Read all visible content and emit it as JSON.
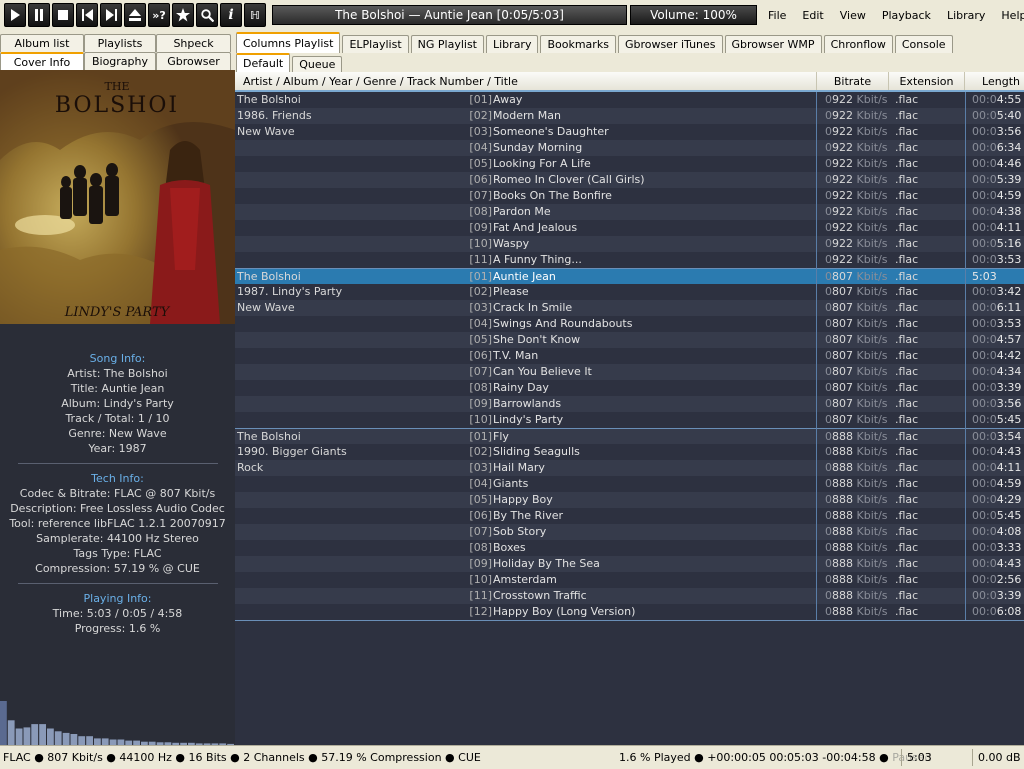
{
  "toolbar": {
    "play": "play-icon",
    "pause": "pause-icon",
    "stop": "stop-icon",
    "previous": "previous-icon",
    "next": "next-icon",
    "eject": "eject-icon",
    "random_label": "»?",
    "favorite": "star-icon",
    "search": "search-icon",
    "info_label": "i",
    "tags_label": "ℍ"
  },
  "now_playing": "The Bolshoi — Auntie Jean [0:05/5:03]",
  "volume": "Volume: 100%",
  "menu": [
    "File",
    "Edit",
    "View",
    "Playback",
    "Library",
    "Help"
  ],
  "left_tabs_row1": [
    "Album list",
    "Playlists",
    "Shpeck"
  ],
  "left_tabs_row2": [
    "Cover Info",
    "Biography",
    "Gbrowser"
  ],
  "cover": {
    "band": "THE BOLSHOI",
    "album": "LINDY'S PARTY"
  },
  "song_info": {
    "header": "Song Info:",
    "artist": "Artist: The Bolshoi",
    "title": "Title: Auntie Jean",
    "album": "Album: Lindy's Party",
    "track": "Track / Total: 1 / 10",
    "genre": "Genre: New Wave",
    "year": "Year: 1987"
  },
  "tech_info": {
    "header": "Tech Info:",
    "codec": "Codec & Bitrate: FLAC @ 807 Kbit/s",
    "description": "Description: Free Lossless Audio Codec",
    "tool": "Tool: reference libFLAC 1.2.1 20070917",
    "samplerate": "Samplerate: 44100 Hz Stereo",
    "tags": "Tags Type: FLAC",
    "compression": "Compression: 57.19 % @ CUE"
  },
  "playing_info": {
    "header": "Playing Info:",
    "time": "Time: 5:03 / 0:05 / 4:58",
    "progress": "Progress: 1.6 %"
  },
  "visualizer_levels": [
    0.8,
    0.45,
    0.3,
    0.32,
    0.38,
    0.38,
    0.3,
    0.25,
    0.22,
    0.2,
    0.16,
    0.16,
    0.12,
    0.12,
    0.1,
    0.1,
    0.08,
    0.08,
    0.06,
    0.06,
    0.05,
    0.05,
    0.04,
    0.04,
    0.04,
    0.03,
    0.03,
    0.03,
    0.03,
    0.02
  ],
  "playlist_tabs": [
    "Columns Playlist",
    "ELPlaylist",
    "NG Playlist",
    "Library",
    "Bookmarks",
    "Gbrowser iTunes",
    "Gbrowser WMP",
    "Chronflow",
    "Console"
  ],
  "sub_tabs": [
    "Default",
    "Queue"
  ],
  "columns": {
    "main": "Artist / Album / Year / Genre / Track Number / Title",
    "bitrate": "Bitrate",
    "extension": "Extension",
    "length": "Length"
  },
  "tracks": [
    {
      "group": "The Bolshoi",
      "num": "[01]",
      "title": "Away",
      "br_dim": "0",
      "br": "922",
      "unit": "Kbit/s",
      "ext": ".flac",
      "len_dim": "00:0",
      "len": "4:55"
    },
    {
      "group": "1986. Friends",
      "num": "[02]",
      "title": "Modern Man",
      "br_dim": "0",
      "br": "922",
      "unit": "Kbit/s",
      "ext": ".flac",
      "len_dim": "00:0",
      "len": "5:40"
    },
    {
      "group": "New Wave",
      "num": "[03]",
      "title": "Someone's Daughter",
      "br_dim": "0",
      "br": "922",
      "unit": "Kbit/s",
      "ext": ".flac",
      "len_dim": "00:0",
      "len": "3:56"
    },
    {
      "group": "",
      "num": "[04]",
      "title": "Sunday Morning",
      "br_dim": "0",
      "br": "922",
      "unit": "Kbit/s",
      "ext": ".flac",
      "len_dim": "00:0",
      "len": "6:34"
    },
    {
      "group": "",
      "num": "[05]",
      "title": "Looking For A Life",
      "br_dim": "0",
      "br": "922",
      "unit": "Kbit/s",
      "ext": ".flac",
      "len_dim": "00:0",
      "len": "4:46"
    },
    {
      "group": "",
      "num": "[06]",
      "title": "Romeo In Clover (Call Girls)",
      "br_dim": "0",
      "br": "922",
      "unit": "Kbit/s",
      "ext": ".flac",
      "len_dim": "00:0",
      "len": "5:39"
    },
    {
      "group": "",
      "num": "[07]",
      "title": "Books On The Bonfire",
      "br_dim": "0",
      "br": "922",
      "unit": "Kbit/s",
      "ext": ".flac",
      "len_dim": "00:0",
      "len": "4:59"
    },
    {
      "group": "",
      "num": "[08]",
      "title": "Pardon Me",
      "br_dim": "0",
      "br": "922",
      "unit": "Kbit/s",
      "ext": ".flac",
      "len_dim": "00:0",
      "len": "4:38"
    },
    {
      "group": "",
      "num": "[09]",
      "title": "Fat And Jealous",
      "br_dim": "0",
      "br": "922",
      "unit": "Kbit/s",
      "ext": ".flac",
      "len_dim": "00:0",
      "len": "4:11"
    },
    {
      "group": "",
      "num": "[10]",
      "title": "Waspy",
      "br_dim": "0",
      "br": "922",
      "unit": "Kbit/s",
      "ext": ".flac",
      "len_dim": "00:0",
      "len": "5:16"
    },
    {
      "group": "",
      "num": "[11]",
      "title": "A Funny Thing...",
      "br_dim": "0",
      "br": "922",
      "unit": "Kbit/s",
      "ext": ".flac",
      "len_dim": "00:0",
      "len": "3:53"
    },
    {
      "group": "The Bolshoi",
      "num": "[01]",
      "title": "Auntie Jean",
      "br_dim": "0",
      "br": "807",
      "unit": "Kbit/s",
      "ext": ".flac",
      "len_dim": "",
      "len": "5:03",
      "playing": true
    },
    {
      "group": "1987. Lindy's Party",
      "num": "[02]",
      "title": "Please",
      "br_dim": "0",
      "br": "807",
      "unit": "Kbit/s",
      "ext": ".flac",
      "len_dim": "00:0",
      "len": "3:42"
    },
    {
      "group": "New Wave",
      "num": "[03]",
      "title": "Crack In Smile",
      "br_dim": "0",
      "br": "807",
      "unit": "Kbit/s",
      "ext": ".flac",
      "len_dim": "00:0",
      "len": "6:11"
    },
    {
      "group": "",
      "num": "[04]",
      "title": "Swings And Roundabouts",
      "br_dim": "0",
      "br": "807",
      "unit": "Kbit/s",
      "ext": ".flac",
      "len_dim": "00:0",
      "len": "3:53"
    },
    {
      "group": "",
      "num": "[05]",
      "title": "She Don't Know",
      "br_dim": "0",
      "br": "807",
      "unit": "Kbit/s",
      "ext": ".flac",
      "len_dim": "00:0",
      "len": "4:57"
    },
    {
      "group": "",
      "num": "[06]",
      "title": "T.V. Man",
      "br_dim": "0",
      "br": "807",
      "unit": "Kbit/s",
      "ext": ".flac",
      "len_dim": "00:0",
      "len": "4:42"
    },
    {
      "group": "",
      "num": "[07]",
      "title": "Can You Believe It",
      "br_dim": "0",
      "br": "807",
      "unit": "Kbit/s",
      "ext": ".flac",
      "len_dim": "00:0",
      "len": "4:34"
    },
    {
      "group": "",
      "num": "[08]",
      "title": "Rainy Day",
      "br_dim": "0",
      "br": "807",
      "unit": "Kbit/s",
      "ext": ".flac",
      "len_dim": "00:0",
      "len": "3:39"
    },
    {
      "group": "",
      "num": "[09]",
      "title": "Barrowlands",
      "br_dim": "0",
      "br": "807",
      "unit": "Kbit/s",
      "ext": ".flac",
      "len_dim": "00:0",
      "len": "3:56"
    },
    {
      "group": "",
      "num": "[10]",
      "title": "Lindy's Party",
      "br_dim": "0",
      "br": "807",
      "unit": "Kbit/s",
      "ext": ".flac",
      "len_dim": "00:0",
      "len": "5:45"
    },
    {
      "group": "The Bolshoi",
      "num": "[01]",
      "title": "Fly",
      "br_dim": "0",
      "br": "888",
      "unit": "Kbit/s",
      "ext": ".flac",
      "len_dim": "00:0",
      "len": "3:54"
    },
    {
      "group": "1990. Bigger Giants",
      "num": "[02]",
      "title": "Sliding Seagulls",
      "br_dim": "0",
      "br": "888",
      "unit": "Kbit/s",
      "ext": ".flac",
      "len_dim": "00:0",
      "len": "4:43"
    },
    {
      "group": "Rock",
      "num": "[03]",
      "title": "Hail Mary",
      "br_dim": "0",
      "br": "888",
      "unit": "Kbit/s",
      "ext": ".flac",
      "len_dim": "00:0",
      "len": "4:11"
    },
    {
      "group": "",
      "num": "[04]",
      "title": "Giants",
      "br_dim": "0",
      "br": "888",
      "unit": "Kbit/s",
      "ext": ".flac",
      "len_dim": "00:0",
      "len": "4:59"
    },
    {
      "group": "",
      "num": "[05]",
      "title": "Happy Boy",
      "br_dim": "0",
      "br": "888",
      "unit": "Kbit/s",
      "ext": ".flac",
      "len_dim": "00:0",
      "len": "4:29"
    },
    {
      "group": "",
      "num": "[06]",
      "title": "By The River",
      "br_dim": "0",
      "br": "888",
      "unit": "Kbit/s",
      "ext": ".flac",
      "len_dim": "00:0",
      "len": "5:45"
    },
    {
      "group": "",
      "num": "[07]",
      "title": "Sob Story",
      "br_dim": "0",
      "br": "888",
      "unit": "Kbit/s",
      "ext": ".flac",
      "len_dim": "00:0",
      "len": "4:08"
    },
    {
      "group": "",
      "num": "[08]",
      "title": "Boxes",
      "br_dim": "0",
      "br": "888",
      "unit": "Kbit/s",
      "ext": ".flac",
      "len_dim": "00:0",
      "len": "3:33"
    },
    {
      "group": "",
      "num": "[09]",
      "title": "Holiday By The Sea",
      "br_dim": "0",
      "br": "888",
      "unit": "Kbit/s",
      "ext": ".flac",
      "len_dim": "00:0",
      "len": "4:43"
    },
    {
      "group": "",
      "num": "[10]",
      "title": "Amsterdam",
      "br_dim": "0",
      "br": "888",
      "unit": "Kbit/s",
      "ext": ".flac",
      "len_dim": "00:0",
      "len": "2:56"
    },
    {
      "group": "",
      "num": "[11]",
      "title": "Crosstown Traffic",
      "br_dim": "0",
      "br": "888",
      "unit": "Kbit/s",
      "ext": ".flac",
      "len_dim": "00:0",
      "len": "3:39"
    },
    {
      "group": "",
      "num": "[12]",
      "title": "Happy Boy (Long Version)",
      "br_dim": "0",
      "br": "888",
      "unit": "Kbit/s",
      "ext": ".flac",
      "len_dim": "00:0",
      "len": "6:08"
    }
  ],
  "status": {
    "info": "FLAC ● 807 Kbit/s ● 44100 Hz ● 16 Bits ● 2 Channels ● 57.19 % Compression ● CUE",
    "played": "1.6 % Played ● +00:00:05  00:05:03  -00:04:58 ● ",
    "paused": "Paused",
    "time": "5:03",
    "gain": "0.00 dB"
  },
  "colors": {
    "panel_bg": "#2a2d37",
    "row_odd": "#2d3140",
    "row_even": "#363b4b",
    "playing_row": "#2b7bb0",
    "accent_text": "#6ab0e8",
    "tab_highlight": "#f0a000"
  }
}
